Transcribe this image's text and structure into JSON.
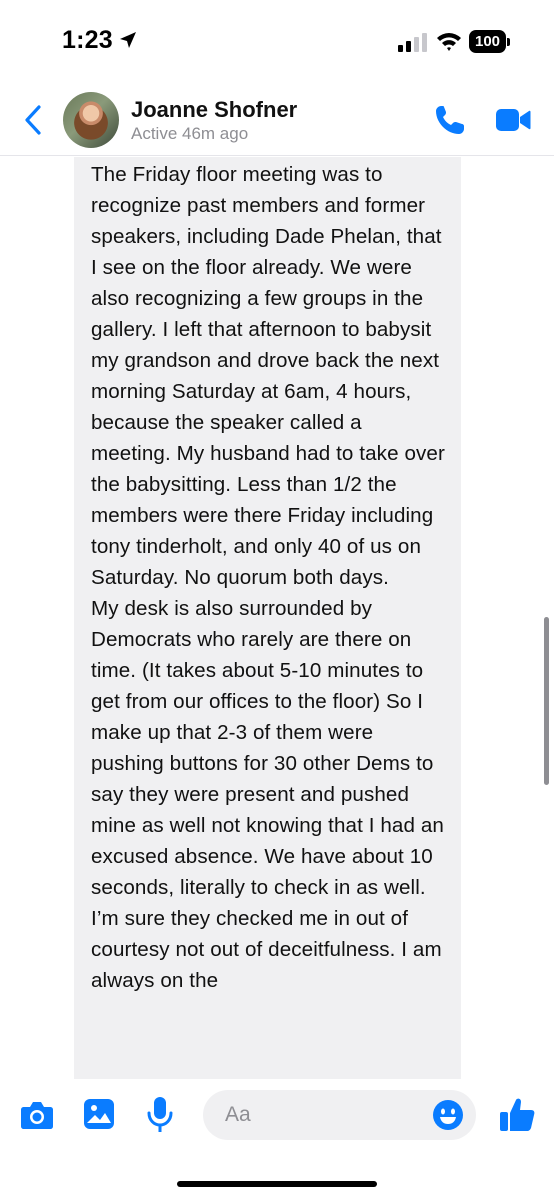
{
  "status_bar": {
    "time": "1:23",
    "battery_level": "100",
    "icons": [
      "location-arrow-icon",
      "cellular-signal-icon",
      "wifi-icon",
      "battery-icon"
    ]
  },
  "header": {
    "contact_name": "Joanne Shofner",
    "contact_status": "Active 46m ago",
    "icons": [
      "back-chevron-icon",
      "phone-icon",
      "video-camera-icon"
    ],
    "accent_color": "#0a7cff"
  },
  "conversation": {
    "message_text": "The Friday floor meeting was to recognize past members and former speakers, including Dade Phelan, that I see on the floor already. We were also recognizing a few groups in the gallery. I left that afternoon to babysit my grandson and drove back the next morning Saturday at 6am, 4 hours, because the speaker called a meeting. My husband had to take over the babysitting. Less than 1/2 the members were there Friday including tony tinderholt, and only 40 of us on Saturday. No quorum both days.\nMy desk is also surrounded by Democrats who rarely are there on time. (It takes about 5-10 minutes to get from our offices to the floor) So I make up that 2-3 of them were pushing buttons for 30 other Dems to say they were present and pushed mine as well not knowing that I had an excused absence. We have about 10 seconds, literally to check in as well. I’m sure they checked me in out of courtesy not out of deceitfulness. I am always on the",
    "bubble_color": "#f0f0f2"
  },
  "composer": {
    "placeholder": "Aa",
    "icons": [
      "camera-icon",
      "photo-gallery-icon",
      "microphone-icon",
      "emoji-icon",
      "thumbs-up-icon"
    ]
  }
}
